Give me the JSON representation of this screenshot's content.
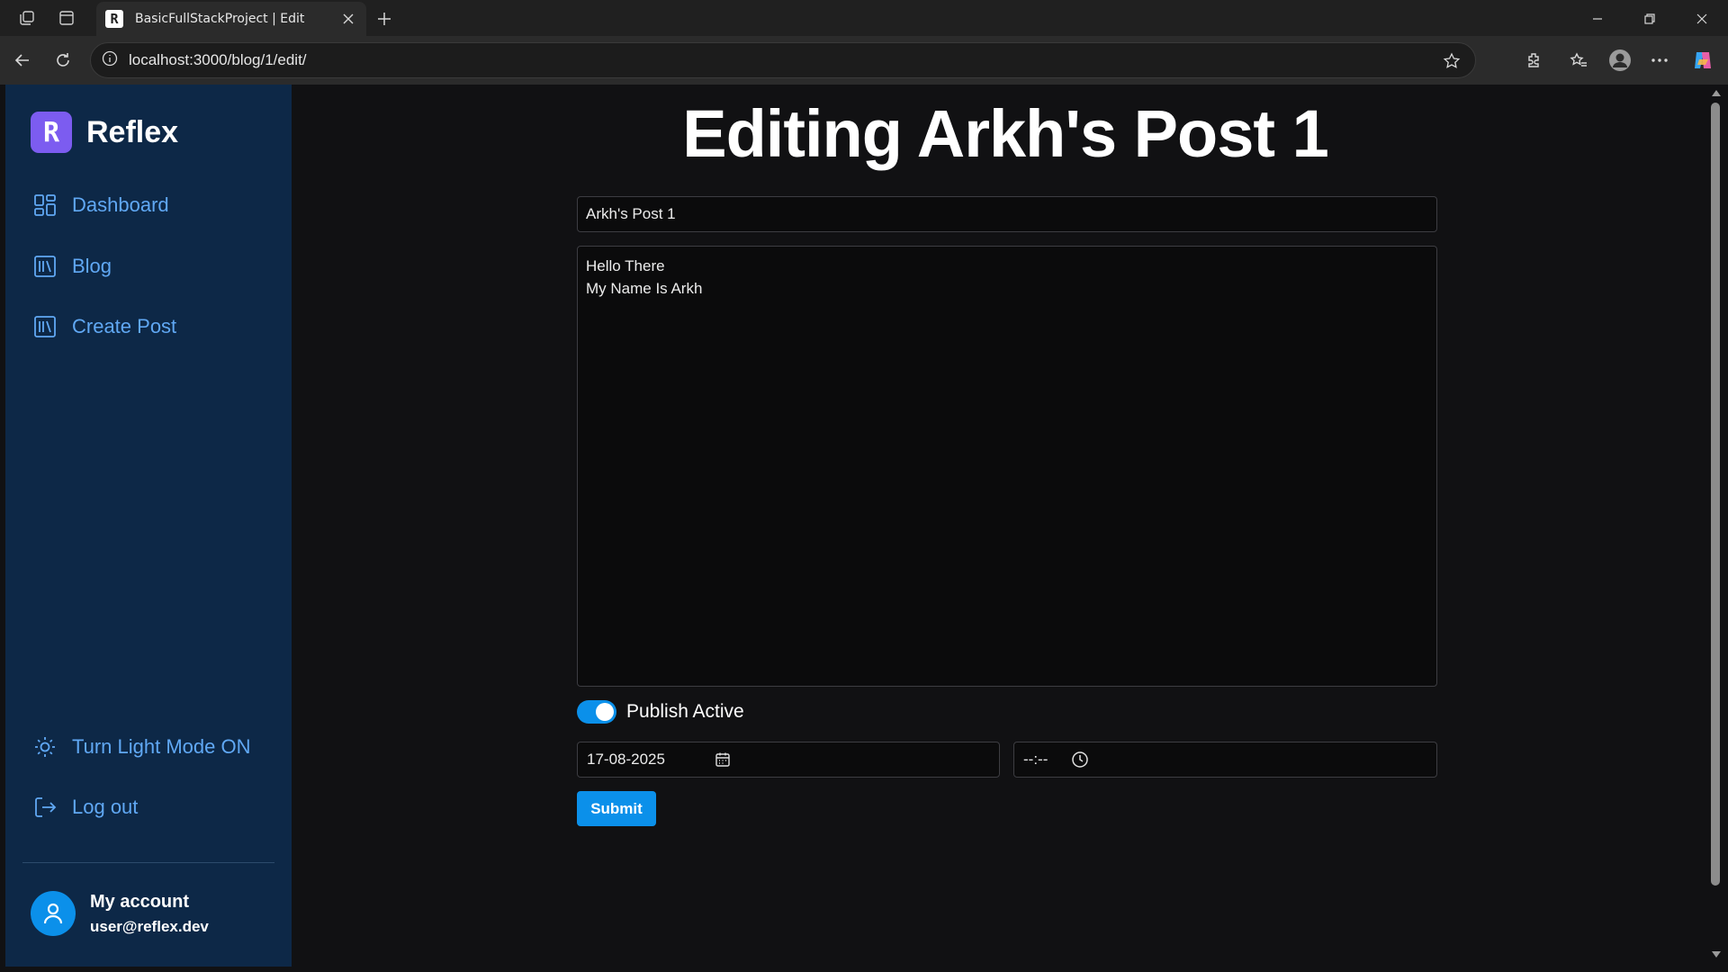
{
  "browser": {
    "tab_title": "BasicFullStackProject | Edit",
    "url": "localhost:3000/blog/1/edit/"
  },
  "sidebar": {
    "brand": "Reflex",
    "items": [
      {
        "label": "Dashboard",
        "icon": "layout-grid-icon"
      },
      {
        "label": "Blog",
        "icon": "library-icon"
      },
      {
        "label": "Create Post",
        "icon": "library-icon"
      }
    ],
    "light_mode_label": "Turn Light Mode ON",
    "logout_label": "Log out",
    "account": {
      "name": "My account",
      "email": "user@reflex.dev"
    }
  },
  "main": {
    "heading": "Editing Arkh's Post 1",
    "title_value": "Arkh's Post 1",
    "content_lines": [
      "Hello There",
      "My Name Is Arkh"
    ],
    "publish_label": "Publish Active",
    "publish_active": true,
    "date_value": "17-08-2025",
    "time_value": "--:--",
    "submit_label": "Submit"
  },
  "colors": {
    "sidebar_bg": "#0d2847",
    "accent": "#0b90ea",
    "nav_text": "#60a8f4",
    "page_bg": "#111113"
  }
}
